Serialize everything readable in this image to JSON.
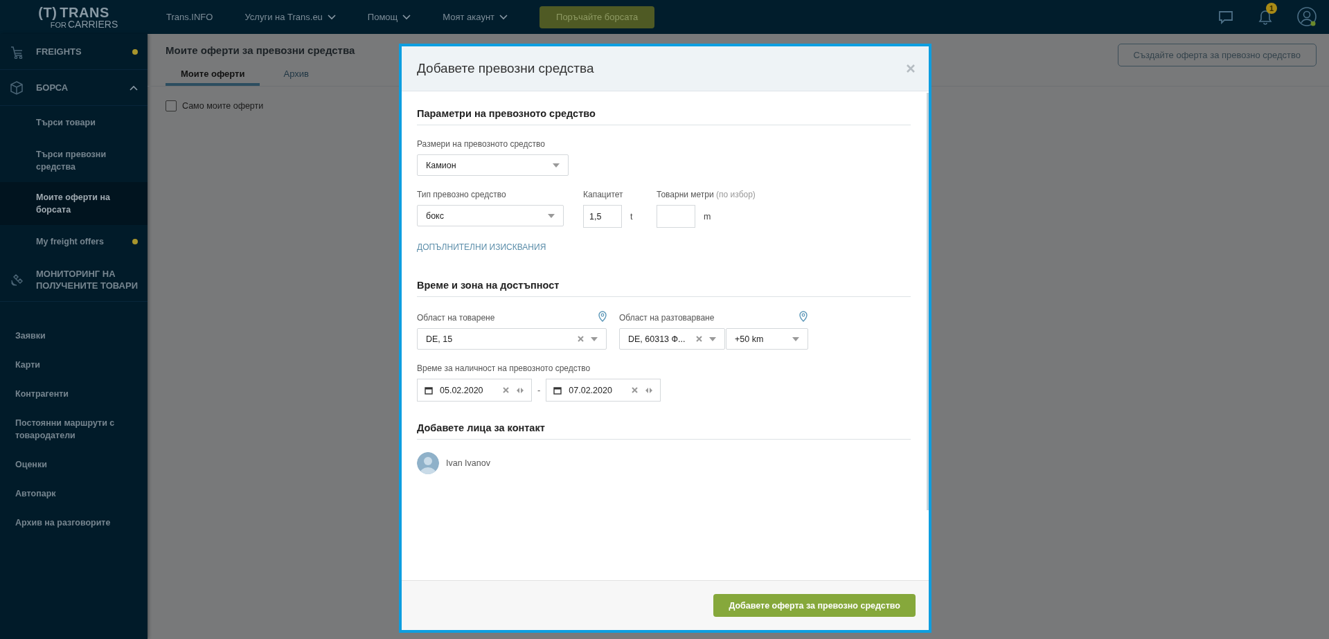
{
  "topbar": {
    "logo": {
      "mark": "(T)",
      "name": "TRANS",
      "tag_1": "FOR",
      "tag_2": "CARRIERS"
    },
    "nav": [
      {
        "label": "Trans.INFO",
        "dropdown": false
      },
      {
        "label": "Услуги на Trans.eu",
        "dropdown": true
      },
      {
        "label": "Помощ",
        "dropdown": true
      },
      {
        "label": "Моят акаунт",
        "dropdown": true
      }
    ],
    "order_button": "Поръчайте борсата",
    "notifications_badge": "1"
  },
  "sidebar": {
    "items": [
      {
        "kind": "module",
        "label": "FREIGHTS",
        "color": "#a8952c"
      },
      {
        "kind": "module",
        "label": "БОРСА",
        "expanded": true,
        "children": [
          {
            "label": "Търси товари",
            "selected": false
          },
          {
            "label": "Търси превозни средства",
            "selected": false
          },
          {
            "label": "Моите оферти на борсата",
            "selected": true
          },
          {
            "label": "My freight offers",
            "selected": false,
            "color": "#a8952c"
          }
        ]
      },
      {
        "kind": "module",
        "label": "МОНИТОРИНГ НА ПОЛУЧЕНИТЕ ТОВАРИ"
      },
      {
        "kind": "link",
        "label": "Заявки"
      },
      {
        "kind": "link",
        "label": "Карти"
      },
      {
        "kind": "link",
        "label": "Контрагенти"
      },
      {
        "kind": "link",
        "label": "Постоянни маршрути с товародатели"
      },
      {
        "kind": "link",
        "label": "Оценки"
      },
      {
        "kind": "link",
        "label": "Автопарк"
      },
      {
        "kind": "link",
        "label": "Архив на разговорите"
      }
    ]
  },
  "page": {
    "title": "Моите оферти за превозни средства",
    "tabs": [
      {
        "label": "Моите оферти",
        "selected": true
      },
      {
        "label": "Архив",
        "selected": false
      }
    ],
    "filter": {
      "label": "Само моите оферти",
      "checked": false
    },
    "create_button": "Създайте оферта за превозно средство"
  },
  "modal": {
    "title": "Добавете превозни средства",
    "vehicle": {
      "heading": "Параметри на превозното средство",
      "size": {
        "label": "Размери на превозното средство",
        "value": "Камион"
      },
      "type": {
        "label": "Тип превозно средство",
        "value": "бокс"
      },
      "capacity": {
        "label": "Капацитет",
        "value": "1,5",
        "unit": "t"
      },
      "load_meters": {
        "label": "Товарни метри",
        "hint": "(по избор)",
        "unit": "m"
      },
      "link": "ДОПЪЛНИТЕЛНИ ИЗИСКВАНИЯ"
    },
    "availability": {
      "heading": "Време и зона на достъпност",
      "loading": {
        "label": "Област на товарене",
        "value": "DE, 15"
      },
      "unloading": {
        "label": "Област на разтоварване",
        "value": "DE, 60313 Ф...",
        "radius": "+50 km"
      },
      "dates": {
        "label": "Време за наличност на превозното средство",
        "from": "05.02.2020",
        "separator": "-",
        "to": "07.02.2020"
      }
    },
    "contacts": {
      "heading": "Добавете лица за контакт",
      "people": [
        {
          "name": "Ivan Ivanov"
        }
      ]
    },
    "submit_button": "Добавете оферта за превозно средство"
  }
}
